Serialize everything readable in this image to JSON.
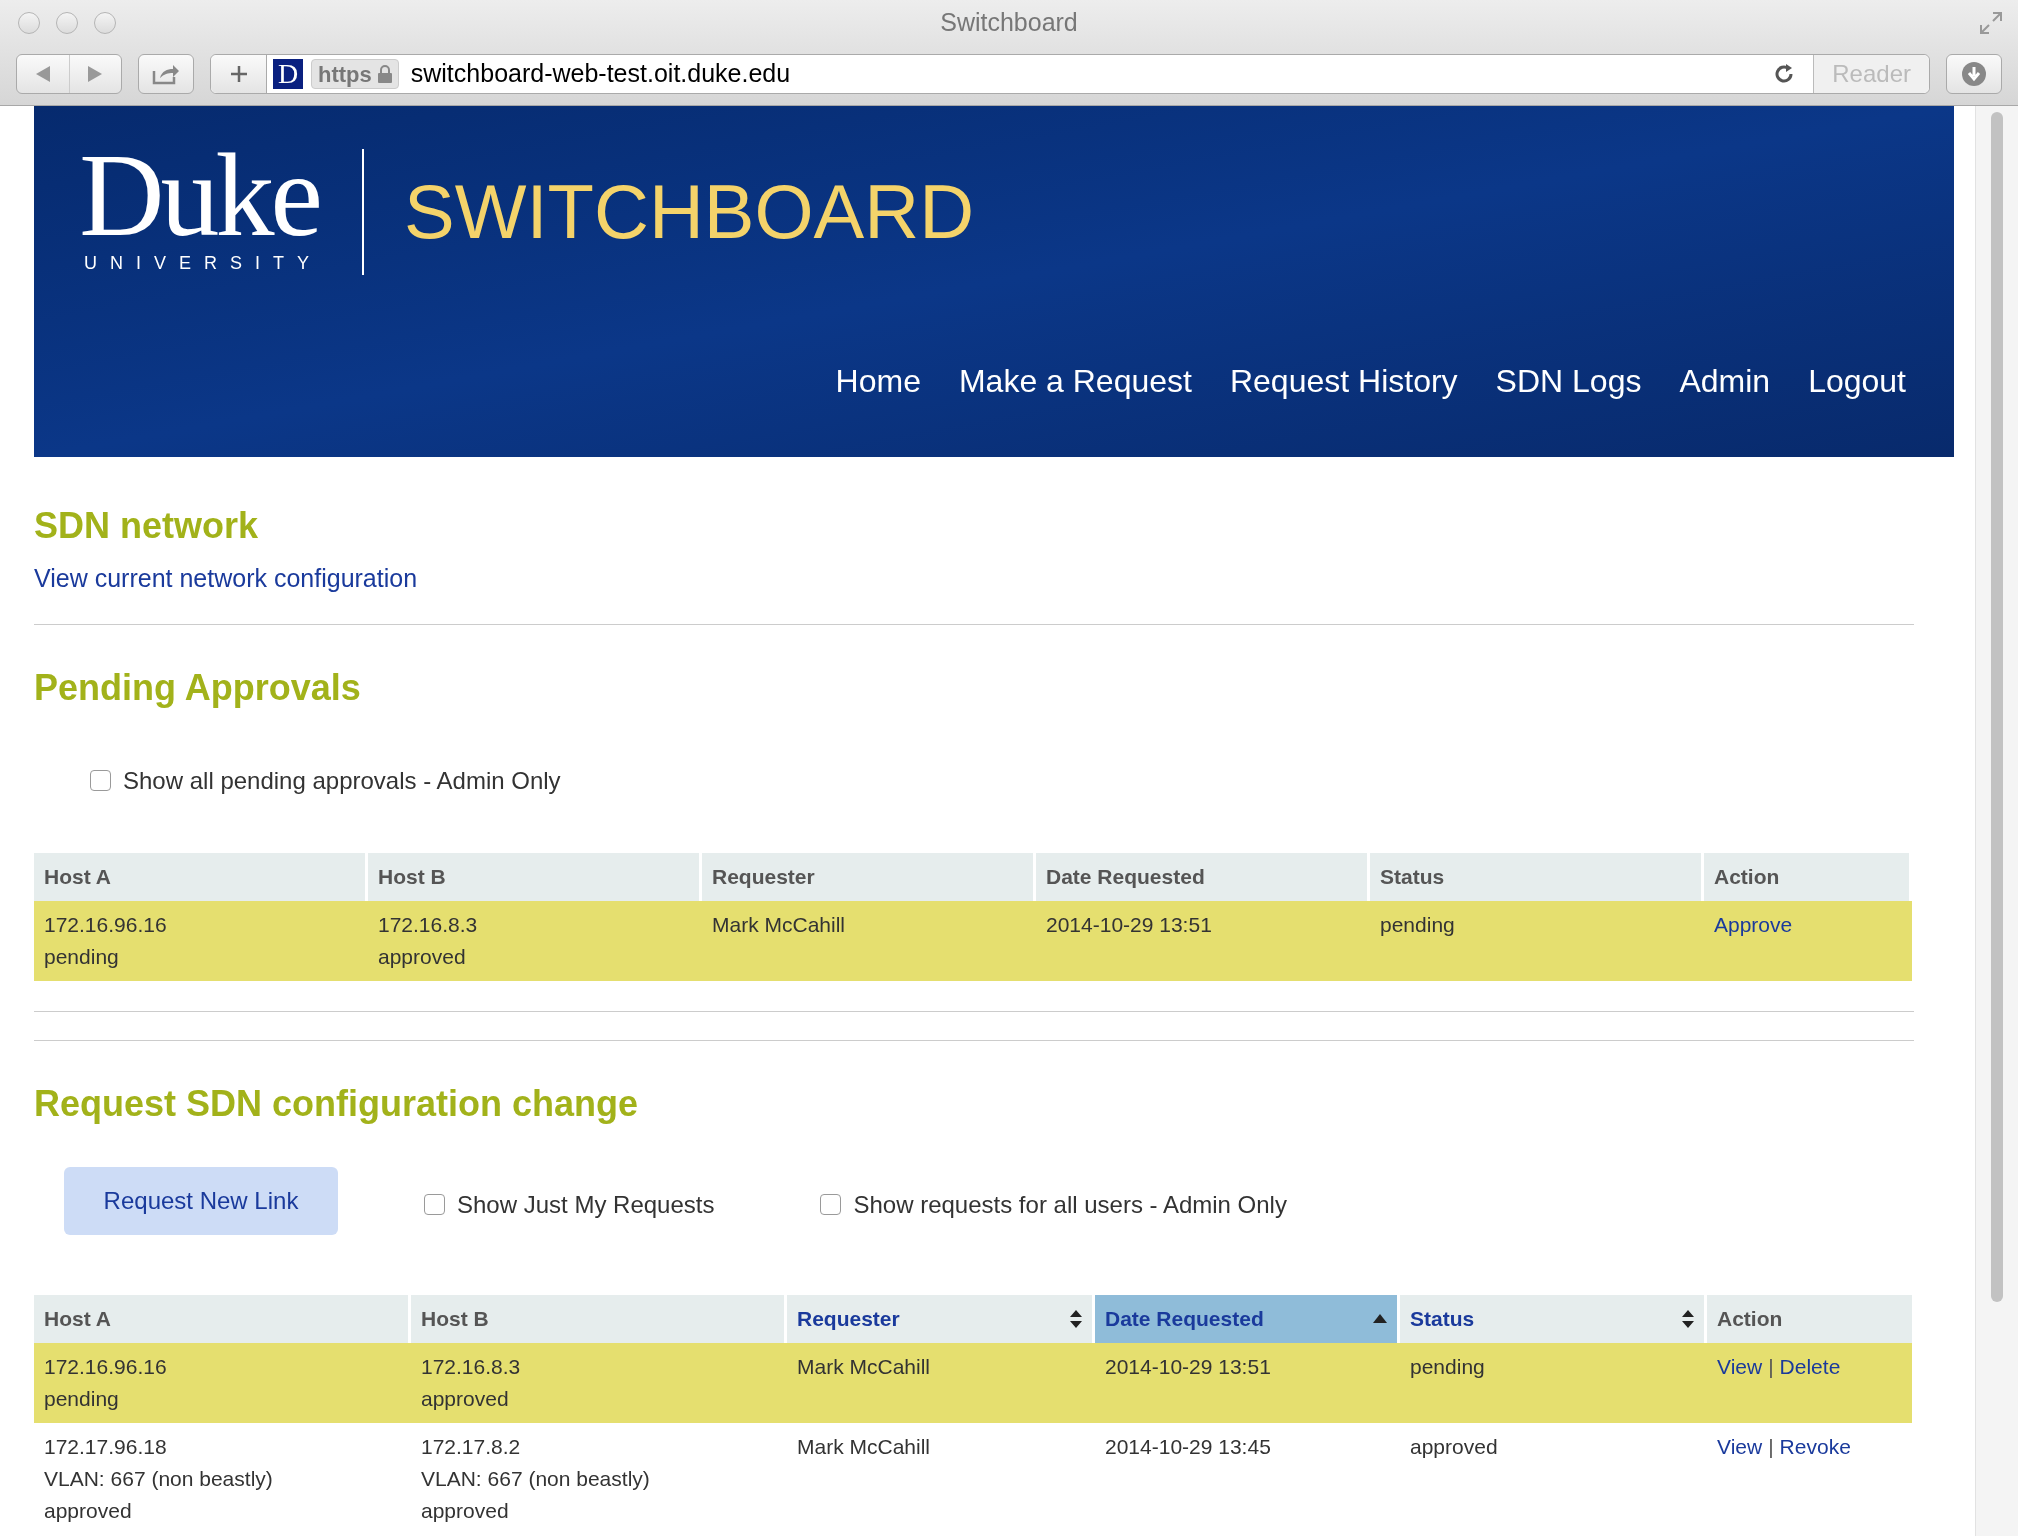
{
  "browser": {
    "title": "Switchboard",
    "favicon_letter": "D",
    "url_scheme": "https",
    "url": "switchboard-web-test.oit.duke.edu",
    "reader_button": "Reader"
  },
  "header": {
    "logo_word": "Duke",
    "logo_sub": "UNIVERSITY",
    "app_title": "SWITCHBOARD",
    "nav": [
      "Home",
      "Make a Request",
      "Request History",
      "SDN Logs",
      "Admin",
      "Logout"
    ]
  },
  "sdn_network": {
    "heading": "SDN network",
    "link": "View current network configuration"
  },
  "pending_approvals": {
    "heading": "Pending Approvals",
    "checkbox": {
      "label": "Show all pending approvals - Admin Only",
      "checked": false
    },
    "table": {
      "columns": [
        {
          "label": "Host A",
          "sortable": false,
          "sorted_ascending": false
        },
        {
          "label": "Host B",
          "sortable": false,
          "sorted_ascending": false
        },
        {
          "label": "Requester",
          "sortable": false,
          "sorted_ascending": false
        },
        {
          "label": "Date Requested",
          "sortable": false,
          "sorted_ascending": false
        },
        {
          "label": "Status",
          "sortable": false,
          "sorted_ascending": false
        },
        {
          "label": "Action",
          "sortable": false,
          "sorted_ascending": false
        }
      ],
      "rows": [
        {
          "highlighted": true,
          "host_a": [
            "172.16.96.16",
            "pending"
          ],
          "host_b": [
            "172.16.8.3",
            "approved"
          ],
          "requester": "Mark McCahill",
          "date_requested": "2014-10-29 13:51",
          "status": "pending",
          "actions": [
            {
              "kind": "link",
              "text": "Approve"
            }
          ]
        }
      ]
    }
  },
  "request_change": {
    "heading": "Request SDN configuration change",
    "button": "Request New Link",
    "checkboxes": [
      {
        "label": "Show Just My Requests",
        "checked": false
      },
      {
        "label": "Show requests for all users - Admin Only",
        "checked": false
      }
    ],
    "table": {
      "columns": [
        {
          "label": "Host A",
          "sortable": false,
          "sorted_ascending": false
        },
        {
          "label": "Host B",
          "sortable": false,
          "sorted_ascending": false
        },
        {
          "label": "Requester",
          "sortable": true,
          "sorted_ascending": false
        },
        {
          "label": "Date Requested",
          "sortable": true,
          "sorted_ascending": true
        },
        {
          "label": "Status",
          "sortable": true,
          "sorted_ascending": false
        },
        {
          "label": "Action",
          "sortable": false,
          "sorted_ascending": false
        }
      ],
      "rows": [
        {
          "highlighted": true,
          "host_a": [
            "172.16.96.16",
            "pending"
          ],
          "host_b": [
            "172.16.8.3",
            "approved"
          ],
          "requester": "Mark McCahill",
          "date_requested": "2014-10-29 13:51",
          "status": "pending",
          "actions": [
            {
              "kind": "link",
              "text": "View"
            },
            {
              "kind": "separator",
              "text": "|"
            },
            {
              "kind": "link",
              "text": "Delete"
            }
          ]
        },
        {
          "highlighted": false,
          "host_a": [
            "172.17.96.18",
            "VLAN: 667 (non beastly)",
            "approved"
          ],
          "host_b": [
            "172.17.8.2",
            "VLAN: 667 (non beastly)",
            "approved"
          ],
          "requester": "Mark McCahill",
          "date_requested": "2014-10-29 13:45",
          "status": "approved",
          "actions": [
            {
              "kind": "link",
              "text": "View"
            },
            {
              "kind": "separator",
              "text": "|"
            },
            {
              "kind": "link",
              "text": "Revoke"
            }
          ]
        }
      ]
    }
  }
}
